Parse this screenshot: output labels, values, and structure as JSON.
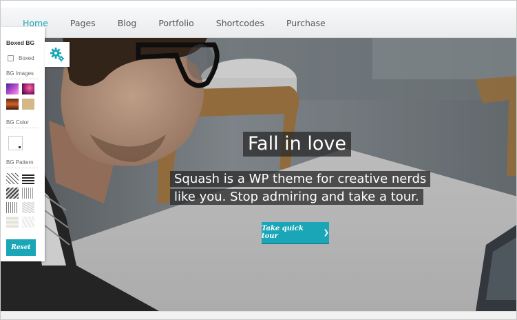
{
  "nav": {
    "items": [
      {
        "label": "Home",
        "active": true
      },
      {
        "label": "Pages",
        "active": false
      },
      {
        "label": "Blog",
        "active": false
      },
      {
        "label": "Portfolio",
        "active": false
      },
      {
        "label": "Shortcodes",
        "active": false
      },
      {
        "label": "Purchase",
        "active": false
      }
    ]
  },
  "hero": {
    "title": "Fall in love",
    "subtitle_line1": "Squash is a WP theme for creative nerds",
    "subtitle_line2": "like you. Stop admiring and take a tour.",
    "cta_label": "Take quick tour",
    "cta_icon": "chevron-right-icon"
  },
  "switcher": {
    "heading": "Boxed BG",
    "boxed_label": "Boxed",
    "bg_images_label": "BG Images",
    "bg_color_label": "BG Color",
    "bg_pattern_label": "BG Pattern",
    "reset_label": "Reset",
    "toggle_icon": "gear-icon"
  },
  "colors": {
    "accent": "#1aa6b7",
    "nav_text": "#555555",
    "overlay": "#282828"
  }
}
